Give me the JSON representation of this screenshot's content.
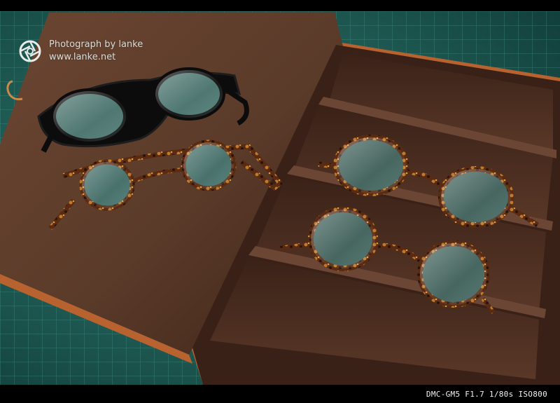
{
  "photo": {
    "watermark": {
      "line1": "Photograph by lanke",
      "line2": "www.lanke.net",
      "logo_icon": "aperture-icon"
    },
    "exif": "DMC-GM5  F1.7  1/80s  ISO800"
  },
  "colors": {
    "border": "#000000",
    "cutting_mat": "#2f7d72",
    "suede": "#5a3a29",
    "leather_edge": "#b8622f",
    "text": "#f2f2f2"
  }
}
